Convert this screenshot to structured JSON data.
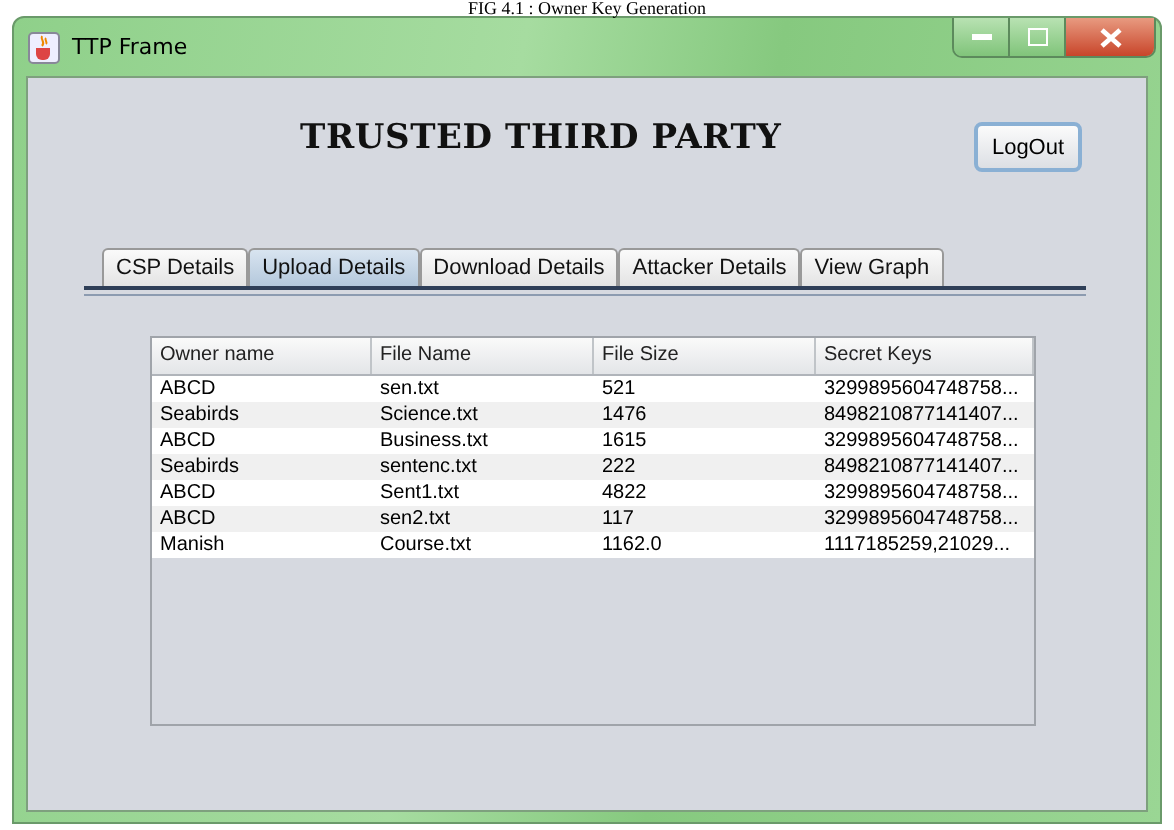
{
  "caption": "FIG 4.1 : Owner Key Generation",
  "window": {
    "title": "TTP Frame"
  },
  "heading": "TRUSTED THIRD PARTY",
  "logout_button": "LogOut",
  "tabs": [
    {
      "label": "CSP Details",
      "selected": false
    },
    {
      "label": "Upload Details",
      "selected": true
    },
    {
      "label": "Download Details",
      "selected": false
    },
    {
      "label": "Attacker Details",
      "selected": false
    },
    {
      "label": "View Graph",
      "selected": false
    }
  ],
  "table": {
    "columns": [
      "Owner name",
      "File Name",
      "File Size",
      "Secret Keys"
    ],
    "rows": [
      [
        "ABCD",
        "sen.txt",
        "521",
        "3299895604748758..."
      ],
      [
        "Seabirds",
        "Science.txt",
        "1476",
        "8498210877141407..."
      ],
      [
        "ABCD",
        "Business.txt",
        "1615",
        "3299895604748758..."
      ],
      [
        "Seabirds",
        "sentenc.txt",
        "222",
        "8498210877141407..."
      ],
      [
        "ABCD",
        "Sent1.txt",
        "4822",
        "3299895604748758..."
      ],
      [
        "ABCD",
        "sen2.txt",
        "117",
        "3299895604748758..."
      ],
      [
        "Manish",
        "Course.txt",
        "1162.0",
        "1117185259,21029..."
      ]
    ]
  }
}
